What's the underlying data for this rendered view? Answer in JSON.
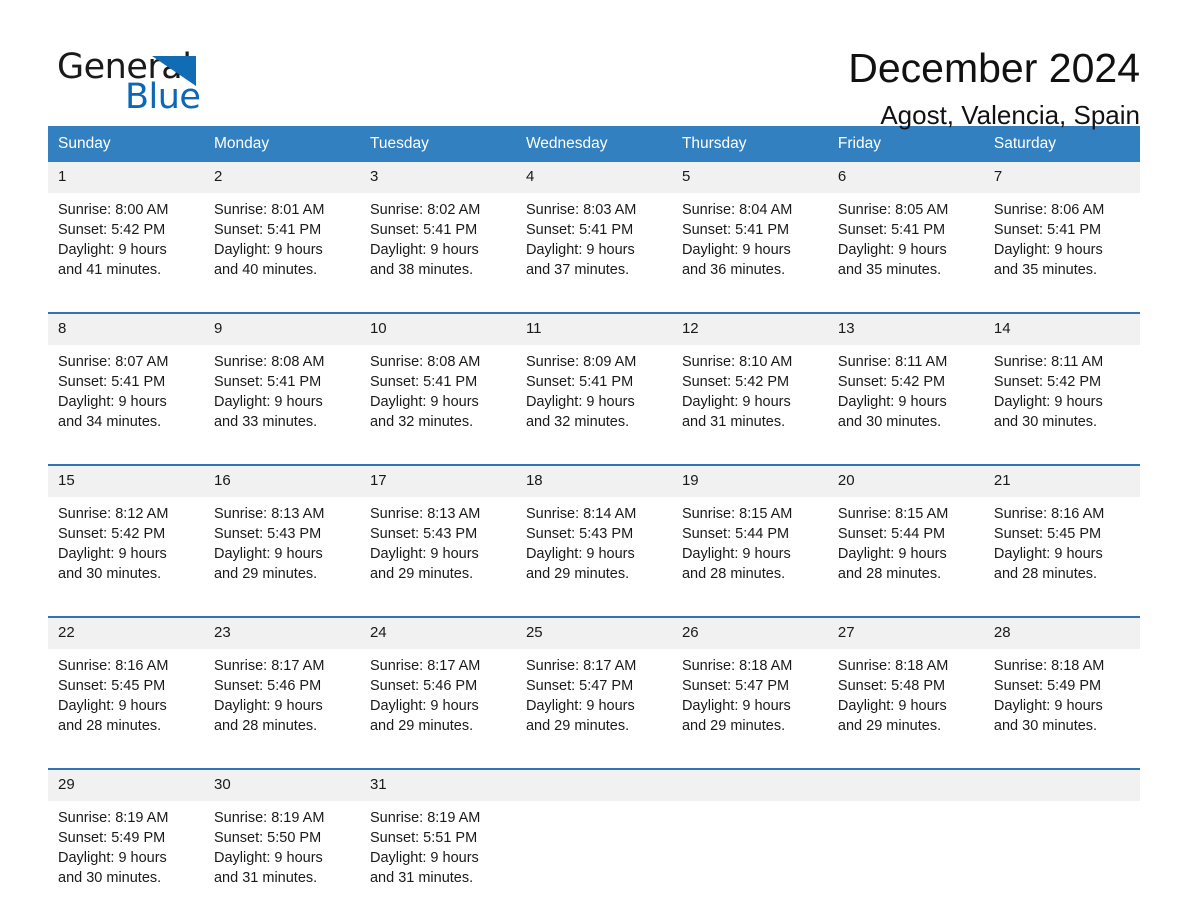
{
  "brand": {
    "word_one": "General",
    "word_two": "Blue",
    "triangle_color": "#0f6cb5",
    "blue_text_color": "#0c68b4"
  },
  "header": {
    "month_title": "December 2024",
    "location": "Agost, Valencia, Spain"
  },
  "theme": {
    "header_row_color": "#3280c0",
    "week_divider_color": "#2f74b5",
    "daynum_background": "#f1f1f1"
  },
  "day_names": [
    "Sunday",
    "Monday",
    "Tuesday",
    "Wednesday",
    "Thursday",
    "Friday",
    "Saturday"
  ],
  "weeks": [
    [
      {
        "day": "1",
        "sunrise": "Sunrise: 8:00 AM",
        "sunset": "Sunset: 5:42 PM",
        "daylight_1": "Daylight: 9 hours",
        "daylight_2": "and 41 minutes."
      },
      {
        "day": "2",
        "sunrise": "Sunrise: 8:01 AM",
        "sunset": "Sunset: 5:41 PM",
        "daylight_1": "Daylight: 9 hours",
        "daylight_2": "and 40 minutes."
      },
      {
        "day": "3",
        "sunrise": "Sunrise: 8:02 AM",
        "sunset": "Sunset: 5:41 PM",
        "daylight_1": "Daylight: 9 hours",
        "daylight_2": "and 38 minutes."
      },
      {
        "day": "4",
        "sunrise": "Sunrise: 8:03 AM",
        "sunset": "Sunset: 5:41 PM",
        "daylight_1": "Daylight: 9 hours",
        "daylight_2": "and 37 minutes."
      },
      {
        "day": "5",
        "sunrise": "Sunrise: 8:04 AM",
        "sunset": "Sunset: 5:41 PM",
        "daylight_1": "Daylight: 9 hours",
        "daylight_2": "and 36 minutes."
      },
      {
        "day": "6",
        "sunrise": "Sunrise: 8:05 AM",
        "sunset": "Sunset: 5:41 PM",
        "daylight_1": "Daylight: 9 hours",
        "daylight_2": "and 35 minutes."
      },
      {
        "day": "7",
        "sunrise": "Sunrise: 8:06 AM",
        "sunset": "Sunset: 5:41 PM",
        "daylight_1": "Daylight: 9 hours",
        "daylight_2": "and 35 minutes."
      }
    ],
    [
      {
        "day": "8",
        "sunrise": "Sunrise: 8:07 AM",
        "sunset": "Sunset: 5:41 PM",
        "daylight_1": "Daylight: 9 hours",
        "daylight_2": "and 34 minutes."
      },
      {
        "day": "9",
        "sunrise": "Sunrise: 8:08 AM",
        "sunset": "Sunset: 5:41 PM",
        "daylight_1": "Daylight: 9 hours",
        "daylight_2": "and 33 minutes."
      },
      {
        "day": "10",
        "sunrise": "Sunrise: 8:08 AM",
        "sunset": "Sunset: 5:41 PM",
        "daylight_1": "Daylight: 9 hours",
        "daylight_2": "and 32 minutes."
      },
      {
        "day": "11",
        "sunrise": "Sunrise: 8:09 AM",
        "sunset": "Sunset: 5:41 PM",
        "daylight_1": "Daylight: 9 hours",
        "daylight_2": "and 32 minutes."
      },
      {
        "day": "12",
        "sunrise": "Sunrise: 8:10 AM",
        "sunset": "Sunset: 5:42 PM",
        "daylight_1": "Daylight: 9 hours",
        "daylight_2": "and 31 minutes."
      },
      {
        "day": "13",
        "sunrise": "Sunrise: 8:11 AM",
        "sunset": "Sunset: 5:42 PM",
        "daylight_1": "Daylight: 9 hours",
        "daylight_2": "and 30 minutes."
      },
      {
        "day": "14",
        "sunrise": "Sunrise: 8:11 AM",
        "sunset": "Sunset: 5:42 PM",
        "daylight_1": "Daylight: 9 hours",
        "daylight_2": "and 30 minutes."
      }
    ],
    [
      {
        "day": "15",
        "sunrise": "Sunrise: 8:12 AM",
        "sunset": "Sunset: 5:42 PM",
        "daylight_1": "Daylight: 9 hours",
        "daylight_2": "and 30 minutes."
      },
      {
        "day": "16",
        "sunrise": "Sunrise: 8:13 AM",
        "sunset": "Sunset: 5:43 PM",
        "daylight_1": "Daylight: 9 hours",
        "daylight_2": "and 29 minutes."
      },
      {
        "day": "17",
        "sunrise": "Sunrise: 8:13 AM",
        "sunset": "Sunset: 5:43 PM",
        "daylight_1": "Daylight: 9 hours",
        "daylight_2": "and 29 minutes."
      },
      {
        "day": "18",
        "sunrise": "Sunrise: 8:14 AM",
        "sunset": "Sunset: 5:43 PM",
        "daylight_1": "Daylight: 9 hours",
        "daylight_2": "and 29 minutes."
      },
      {
        "day": "19",
        "sunrise": "Sunrise: 8:15 AM",
        "sunset": "Sunset: 5:44 PM",
        "daylight_1": "Daylight: 9 hours",
        "daylight_2": "and 28 minutes."
      },
      {
        "day": "20",
        "sunrise": "Sunrise: 8:15 AM",
        "sunset": "Sunset: 5:44 PM",
        "daylight_1": "Daylight: 9 hours",
        "daylight_2": "and 28 minutes."
      },
      {
        "day": "21",
        "sunrise": "Sunrise: 8:16 AM",
        "sunset": "Sunset: 5:45 PM",
        "daylight_1": "Daylight: 9 hours",
        "daylight_2": "and 28 minutes."
      }
    ],
    [
      {
        "day": "22",
        "sunrise": "Sunrise: 8:16 AM",
        "sunset": "Sunset: 5:45 PM",
        "daylight_1": "Daylight: 9 hours",
        "daylight_2": "and 28 minutes."
      },
      {
        "day": "23",
        "sunrise": "Sunrise: 8:17 AM",
        "sunset": "Sunset: 5:46 PM",
        "daylight_1": "Daylight: 9 hours",
        "daylight_2": "and 28 minutes."
      },
      {
        "day": "24",
        "sunrise": "Sunrise: 8:17 AM",
        "sunset": "Sunset: 5:46 PM",
        "daylight_1": "Daylight: 9 hours",
        "daylight_2": "and 29 minutes."
      },
      {
        "day": "25",
        "sunrise": "Sunrise: 8:17 AM",
        "sunset": "Sunset: 5:47 PM",
        "daylight_1": "Daylight: 9 hours",
        "daylight_2": "and 29 minutes."
      },
      {
        "day": "26",
        "sunrise": "Sunrise: 8:18 AM",
        "sunset": "Sunset: 5:47 PM",
        "daylight_1": "Daylight: 9 hours",
        "daylight_2": "and 29 minutes."
      },
      {
        "day": "27",
        "sunrise": "Sunrise: 8:18 AM",
        "sunset": "Sunset: 5:48 PM",
        "daylight_1": "Daylight: 9 hours",
        "daylight_2": "and 29 minutes."
      },
      {
        "day": "28",
        "sunrise": "Sunrise: 8:18 AM",
        "sunset": "Sunset: 5:49 PM",
        "daylight_1": "Daylight: 9 hours",
        "daylight_2": "and 30 minutes."
      }
    ],
    [
      {
        "day": "29",
        "sunrise": "Sunrise: 8:19 AM",
        "sunset": "Sunset: 5:49 PM",
        "daylight_1": "Daylight: 9 hours",
        "daylight_2": "and 30 minutes."
      },
      {
        "day": "30",
        "sunrise": "Sunrise: 8:19 AM",
        "sunset": "Sunset: 5:50 PM",
        "daylight_1": "Daylight: 9 hours",
        "daylight_2": "and 31 minutes."
      },
      {
        "day": "31",
        "sunrise": "Sunrise: 8:19 AM",
        "sunset": "Sunset: 5:51 PM",
        "daylight_1": "Daylight: 9 hours",
        "daylight_2": "and 31 minutes."
      },
      {
        "day": "",
        "sunrise": "",
        "sunset": "",
        "daylight_1": "",
        "daylight_2": ""
      },
      {
        "day": "",
        "sunrise": "",
        "sunset": "",
        "daylight_1": "",
        "daylight_2": ""
      },
      {
        "day": "",
        "sunrise": "",
        "sunset": "",
        "daylight_1": "",
        "daylight_2": ""
      },
      {
        "day": "",
        "sunrise": "",
        "sunset": "",
        "daylight_1": "",
        "daylight_2": ""
      }
    ]
  ]
}
